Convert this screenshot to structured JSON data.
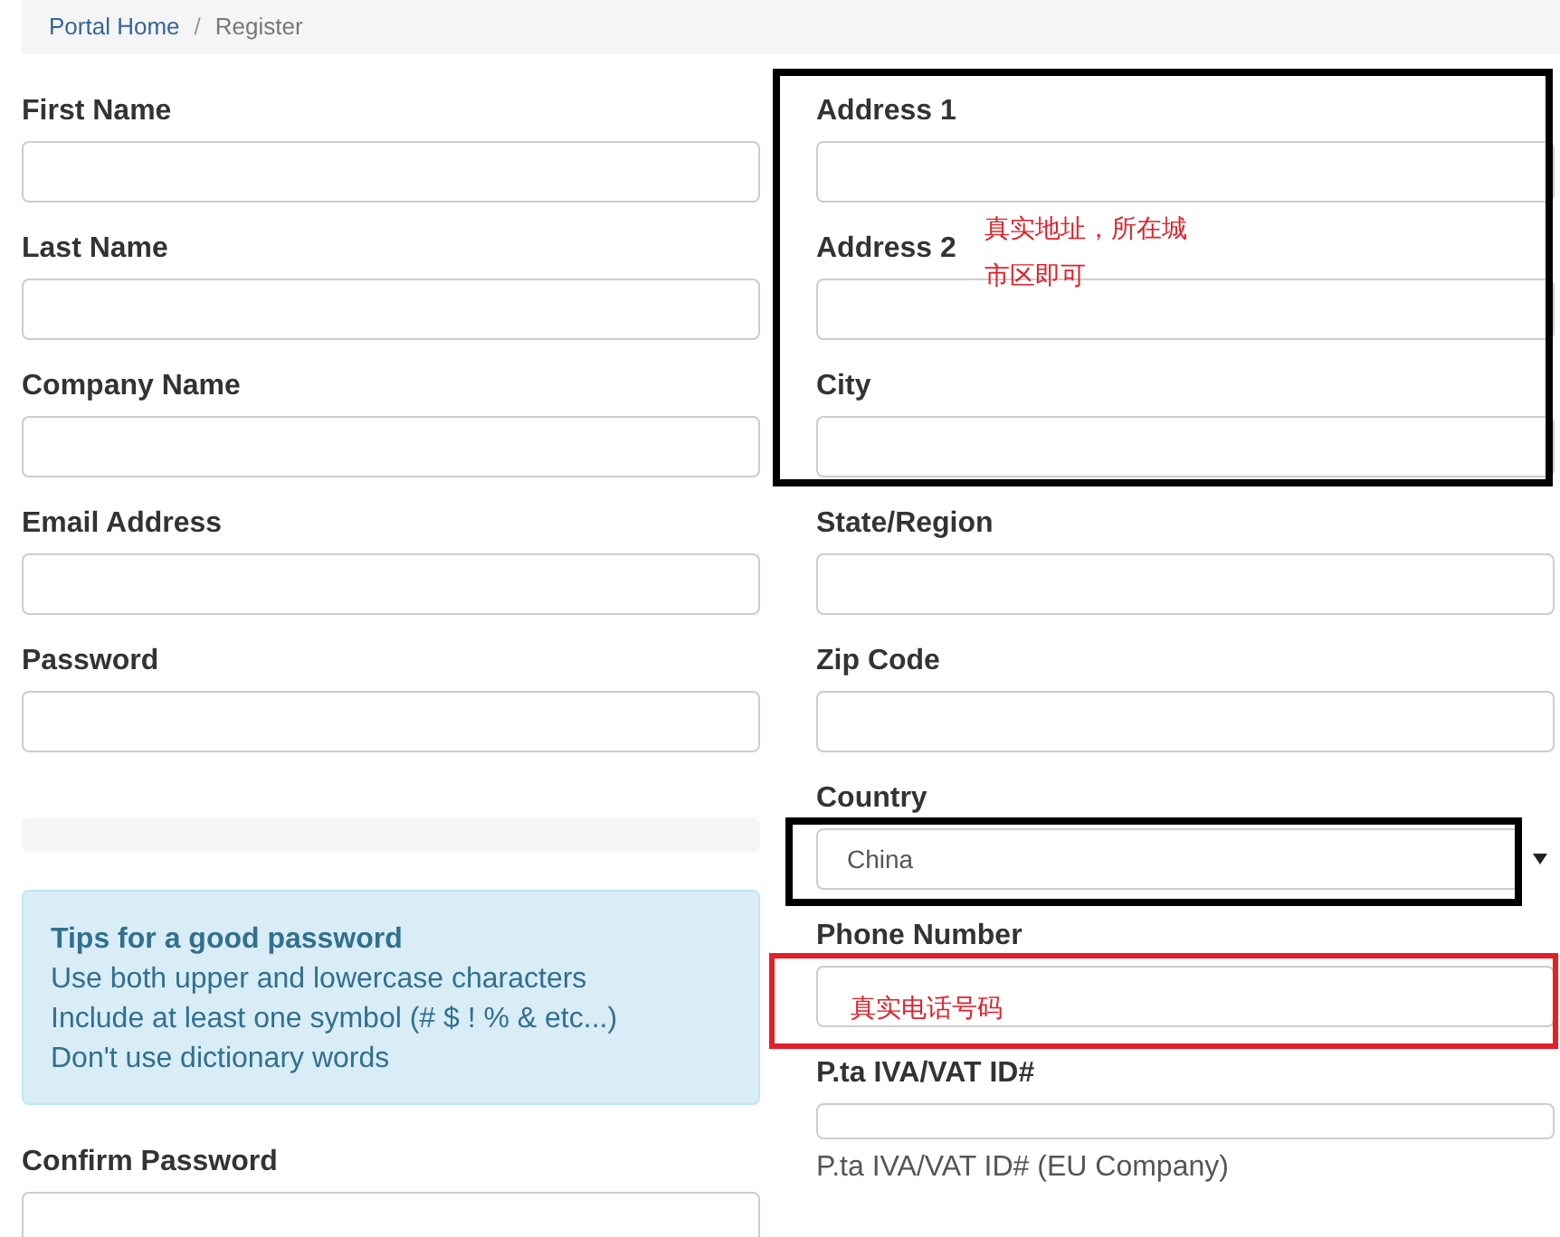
{
  "breadcrumb": {
    "separator": "/",
    "items": [
      {
        "label": "Portal Home",
        "kind": "link"
      },
      {
        "label": "Register",
        "kind": "current"
      }
    ]
  },
  "left_fields": [
    {
      "label": "First Name"
    },
    {
      "label": "Last Name"
    },
    {
      "label": "Company Name"
    },
    {
      "label": "Email Address"
    },
    {
      "label": "Password"
    }
  ],
  "password_strength": {
    "level": 0
  },
  "tips": {
    "title": "Tips for a good password",
    "lines": [
      "Use both upper and lowercase characters",
      "Include at least one symbol (# $ ! % & etc...)",
      "Don't use dictionary words"
    ]
  },
  "confirm_field": {
    "label": "Confirm Password"
  },
  "right_fields": [
    {
      "label": "Address 1",
      "kind": "text"
    },
    {
      "label": "Address 2",
      "kind": "text"
    },
    {
      "label": "City",
      "kind": "text"
    },
    {
      "label": "State/Region",
      "kind": "text"
    },
    {
      "label": "Zip Code",
      "kind": "text"
    },
    {
      "label": "Country",
      "kind": "select",
      "value": "China"
    },
    {
      "label": "Phone Number",
      "kind": "text"
    },
    {
      "label": "P.ta IVA/VAT ID#",
      "kind": "text",
      "help": "P.ta IVA/VAT ID# (EU Company)"
    }
  ],
  "annotations": [
    {
      "kind": "frame",
      "color": "#000000"
    },
    {
      "kind": "frame",
      "color": "#000000"
    },
    {
      "kind": "frame",
      "color": "#e0202a"
    },
    {
      "kind": "note",
      "text": "真实地址，所在城市区即可"
    },
    {
      "kind": "note",
      "text": "真实电话号码"
    }
  ]
}
